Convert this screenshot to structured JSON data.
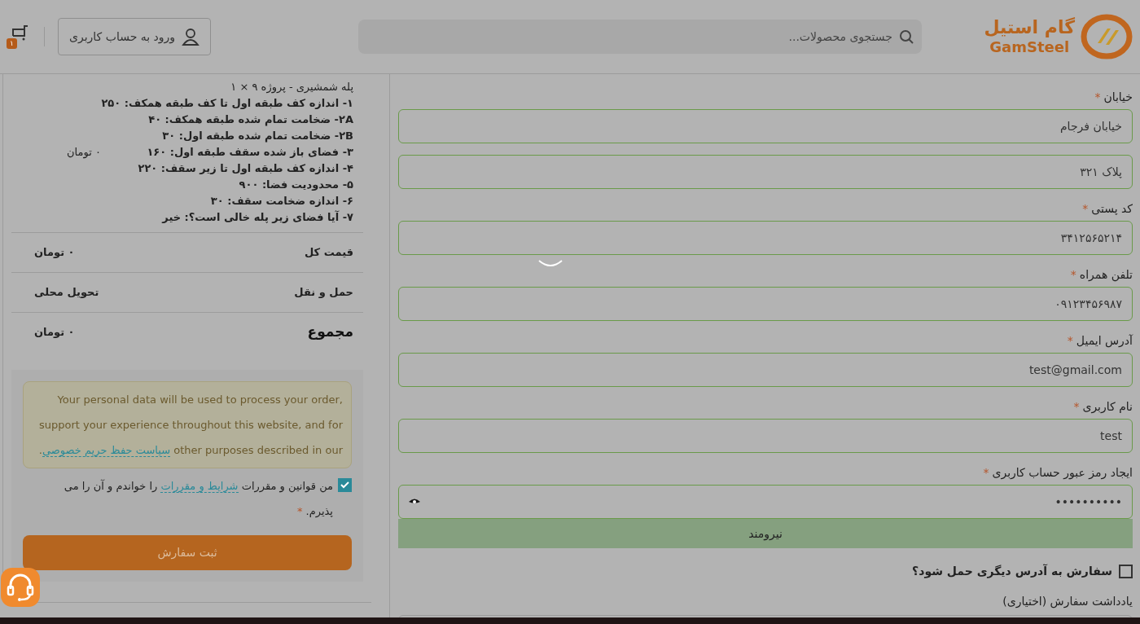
{
  "header": {
    "logo": {
      "persian": "گام استیل",
      "latin": "GamSteel"
    },
    "search": {
      "placeholder": "جستجوی محصولات..."
    },
    "login_button": "ورود به حساب کاربری",
    "cart": {
      "count": "۱"
    }
  },
  "form": {
    "fields": [
      {
        "kind": "text",
        "label": "خیابان",
        "required_mark": "*",
        "value": "خیابان فرجام"
      },
      {
        "kind": "text",
        "value": "پلاک ۳۲۱"
      },
      {
        "kind": "text",
        "label": "کد پستی",
        "required_mark": "*",
        "value": "۳۴۱۲۵۶۵۲۱۴"
      },
      {
        "kind": "text",
        "label": "تلفن همراه",
        "required_mark": "*",
        "value": "۰۹۱۲۳۴۵۶۹۸۷"
      },
      {
        "kind": "text",
        "label": "آدرس ایمیل",
        "required_mark": "*",
        "value": "test@gmail.com"
      },
      {
        "kind": "text",
        "label": "نام کاربری",
        "required_mark": "*",
        "value": "test"
      },
      {
        "kind": "password",
        "label": "ایجاد رمز عبور حساب کاربری",
        "required_mark": "*",
        "value": "••••••••••"
      }
    ],
    "password_strength": "نیرومند",
    "ship_different": {
      "label": "سفارش به آدرس دیگری حمل شود؟",
      "checked": false
    },
    "notes_label": "یادداشت سفارش (اختیاری)"
  },
  "summary": {
    "product": {
      "title": "پله شمشیری - پروژه ۹  × ۱",
      "details": [
        "۱- اندازه کف طبقه اول تا کف طبقه همکف: ۲۵۰",
        "۲A- ضخامت تمام شده طبقه همکف: ۴۰",
        "۲B- ضخامت تمام شده طبقه اول: ۳۰",
        "۳- فضای باز شده سقف طبقه اول: ۱۶۰",
        "۴- اندازه کف طبقه اول تا زیر سقف: ۲۲۰",
        "۵- محدودیت فضا: ۹۰۰",
        "۶- اندازه ضخامت سقف: ۳۰",
        "۷- آیا فضای زیر پله خالی است؟: خیر"
      ],
      "price": "۰ تومان"
    },
    "rows": [
      {
        "label": "قیمت کل",
        "value": "۰ تومان",
        "total": false
      },
      {
        "label": "حمل و نقل",
        "value": "تحویل محلی",
        "total": false
      },
      {
        "label": "مجموع",
        "value": "۰ تومان",
        "total": true
      }
    ],
    "privacy": {
      "text": "Your personal data will be used to process your order, support your experience throughout this website, and for other purposes described in our",
      "link": "سیاست حفظ حریم خصوصی",
      "end": "."
    },
    "terms": {
      "checked": true,
      "before": "من قوانین و مقررات",
      "link": "شرایط و مقررات",
      "after": "را خواندم و آن را می پذیرم.",
      "required_mark": "*"
    },
    "submit": "ثبت سفارش"
  }
}
